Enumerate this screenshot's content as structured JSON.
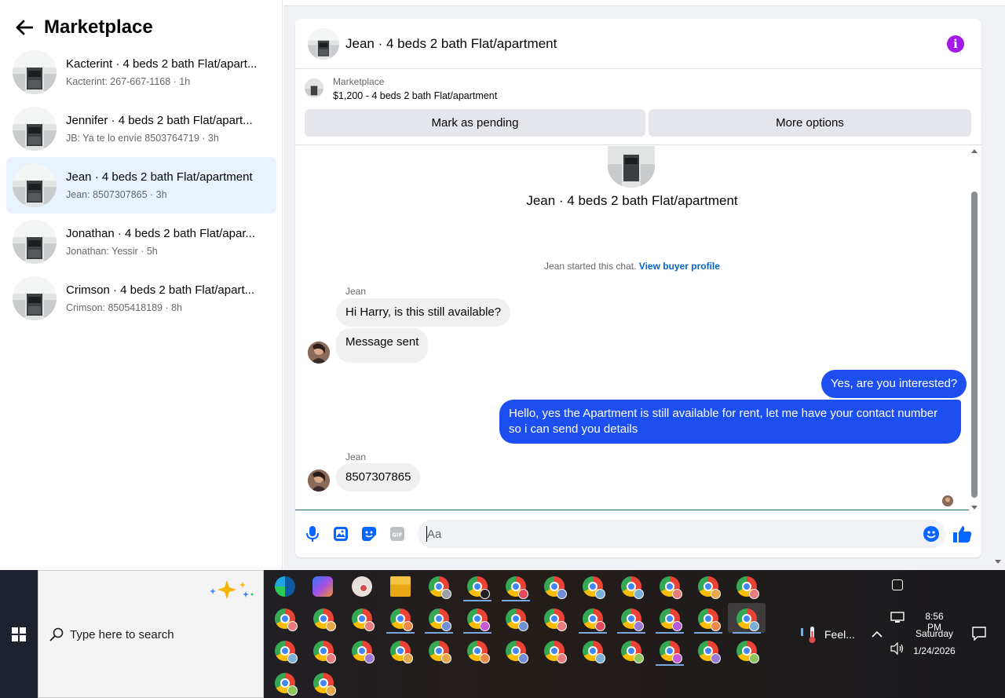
{
  "sidebar": {
    "title": "Marketplace",
    "conversations": [
      {
        "title": "Kacterint · 4 beds 2 bath Flat/apart...",
        "subtitle": "Kacterint: 267-667-1168 · 1h"
      },
      {
        "title": "Jennifer · 4 beds 2 bath Flat/apart...",
        "subtitle": "JB: Ya te lo envíe 8503764719 · 3h"
      },
      {
        "title": "Jean · 4 beds 2 bath Flat/apartment",
        "subtitle": "Jean: 8507307865 · 3h"
      },
      {
        "title": "Jonathan · 4 beds 2 bath Flat/apar...",
        "subtitle": "Jonathan: Yessir · 5h"
      },
      {
        "title": "Crimson · 4 beds 2 bath Flat/apart...",
        "subtitle": "Crimson: 8505418189 · 8h"
      }
    ]
  },
  "chat": {
    "header_title": "Jean · 4 beds 2 bath Flat/apartment",
    "listing": {
      "source": "Marketplace",
      "title": "$1,200 - 4 beds 2 bath Flat/apartment",
      "pending_label": "Mark as pending",
      "more_label": "More options"
    },
    "thread_title": "Jean · 4 beds 2 bath Flat/apartment",
    "started_text": "Jean started this chat. ",
    "view_profile": "View buyer profile",
    "messages": [
      {
        "sender": "Jean",
        "text": "Hi Harry, is this still available?"
      },
      {
        "text": "Message sent"
      },
      {
        "text": "Yes, are you interested?"
      },
      {
        "text": "Hello, yes the Apartment is still available for rent, let me have your contact number so i can send you details"
      },
      {
        "sender": "Jean",
        "text": "8507307865"
      }
    ],
    "composer_placeholder": "Aa",
    "colors": {
      "outgoing": "#1d4ff0",
      "accent": "#0064d1",
      "info": "#a31ae8"
    }
  },
  "taskbar": {
    "search_placeholder": "Type here to search",
    "weather": "Feel...",
    "time": "8:56 PM",
    "day": "Saturday",
    "date": "1/24/2026"
  }
}
